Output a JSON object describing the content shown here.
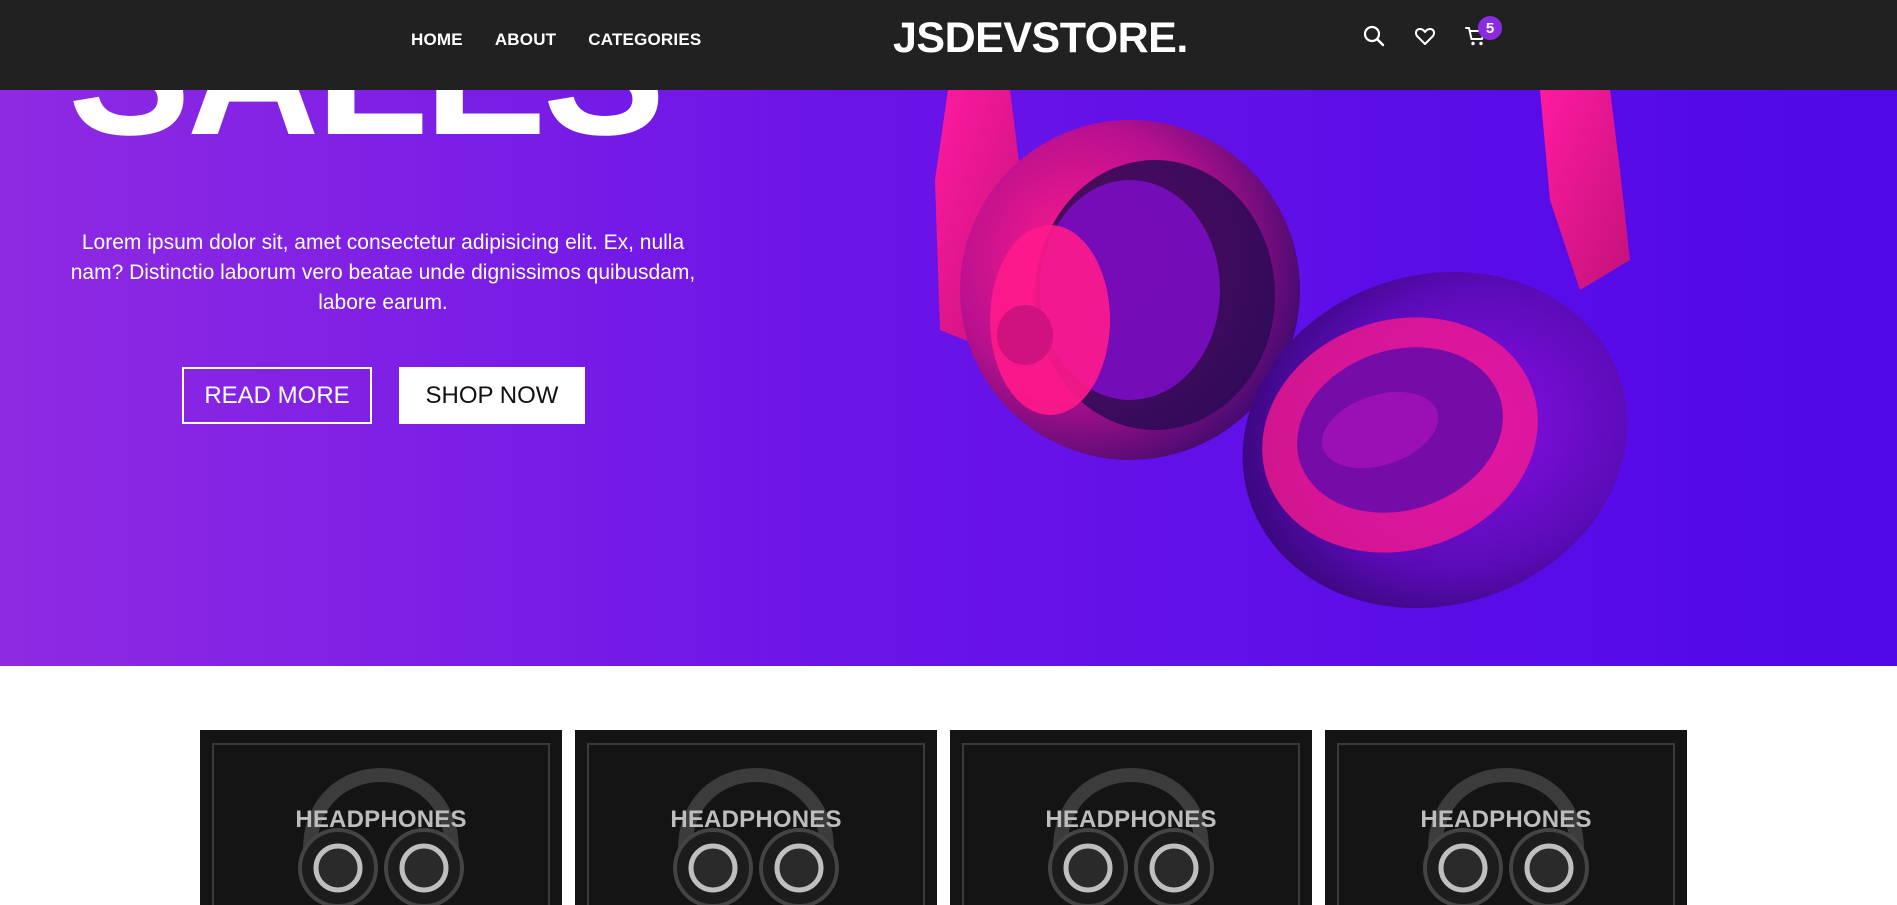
{
  "header": {
    "nav": [
      "HOME",
      "ABOUT",
      "CATEGORIES"
    ],
    "logo": "JSDEVSTORE.",
    "icons": [
      "search-icon",
      "heart-icon",
      "cart-icon"
    ],
    "cart_count": "5"
  },
  "hero": {
    "title": "SALES",
    "text": "Lorem ipsum dolor sit, amet consectetur adipisicing elit. Ex, nulla nam? Distinctio laborum vero beatae unde dignissimos quibusdam, labore earum.",
    "read_more": "READ MORE",
    "shop_now": "SHOP NOW"
  },
  "categories": [
    {
      "label": "HEADPHONES"
    },
    {
      "label": "HEADPHONES"
    },
    {
      "label": "HEADPHONES"
    },
    {
      "label": "HEADPHONES"
    }
  ],
  "colors": {
    "header_bg": "#212121",
    "hero_gradient_start": "#8f2ae2",
    "hero_gradient_end": "#4f08e8",
    "badge": "#8a2be2"
  }
}
